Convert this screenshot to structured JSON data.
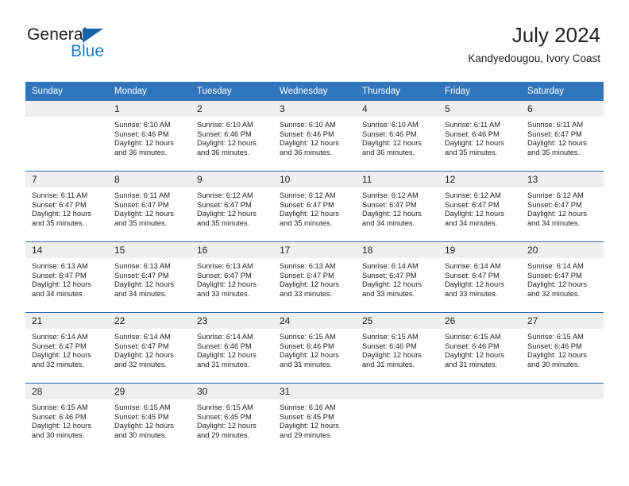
{
  "brand": {
    "word_general": "General",
    "word_blue": "Blue",
    "triangle_icon": "brand-triangle-icon"
  },
  "header": {
    "title": "July 2024",
    "location": "Kandyedougou, Ivory Coast"
  },
  "colors": {
    "header_blue": "#3176bc",
    "row_separator_blue": "#2a6ab0",
    "daynum_background": "#efefef",
    "brand_blue": "#1c7fd6",
    "text": "#231f20"
  },
  "weekday_headers": [
    "Sunday",
    "Monday",
    "Tuesday",
    "Wednesday",
    "Thursday",
    "Friday",
    "Saturday"
  ],
  "weeks": [
    [
      {
        "day": "",
        "blank": true,
        "sunrise": "",
        "sunset": "",
        "daylight1": "",
        "daylight2": ""
      },
      {
        "day": "1",
        "sunrise": "Sunrise: 6:10 AM",
        "sunset": "Sunset: 6:46 PM",
        "daylight1": "Daylight: 12 hours",
        "daylight2": "and 36 minutes."
      },
      {
        "day": "2",
        "sunrise": "Sunrise: 6:10 AM",
        "sunset": "Sunset: 6:46 PM",
        "daylight1": "Daylight: 12 hours",
        "daylight2": "and 36 minutes."
      },
      {
        "day": "3",
        "sunrise": "Sunrise: 6:10 AM",
        "sunset": "Sunset: 6:46 PM",
        "daylight1": "Daylight: 12 hours",
        "daylight2": "and 36 minutes."
      },
      {
        "day": "4",
        "sunrise": "Sunrise: 6:10 AM",
        "sunset": "Sunset: 6:46 PM",
        "daylight1": "Daylight: 12 hours",
        "daylight2": "and 36 minutes."
      },
      {
        "day": "5",
        "sunrise": "Sunrise: 6:11 AM",
        "sunset": "Sunset: 6:46 PM",
        "daylight1": "Daylight: 12 hours",
        "daylight2": "and 35 minutes."
      },
      {
        "day": "6",
        "sunrise": "Sunrise: 6:11 AM",
        "sunset": "Sunset: 6:47 PM",
        "daylight1": "Daylight: 12 hours",
        "daylight2": "and 35 minutes."
      }
    ],
    [
      {
        "day": "7",
        "sunrise": "Sunrise: 6:11 AM",
        "sunset": "Sunset: 6:47 PM",
        "daylight1": "Daylight: 12 hours",
        "daylight2": "and 35 minutes."
      },
      {
        "day": "8",
        "sunrise": "Sunrise: 6:11 AM",
        "sunset": "Sunset: 6:47 PM",
        "daylight1": "Daylight: 12 hours",
        "daylight2": "and 35 minutes."
      },
      {
        "day": "9",
        "sunrise": "Sunrise: 6:12 AM",
        "sunset": "Sunset: 6:47 PM",
        "daylight1": "Daylight: 12 hours",
        "daylight2": "and 35 minutes."
      },
      {
        "day": "10",
        "sunrise": "Sunrise: 6:12 AM",
        "sunset": "Sunset: 6:47 PM",
        "daylight1": "Daylight: 12 hours",
        "daylight2": "and 35 minutes."
      },
      {
        "day": "11",
        "sunrise": "Sunrise: 6:12 AM",
        "sunset": "Sunset: 6:47 PM",
        "daylight1": "Daylight: 12 hours",
        "daylight2": "and 34 minutes."
      },
      {
        "day": "12",
        "sunrise": "Sunrise: 6:12 AM",
        "sunset": "Sunset: 6:47 PM",
        "daylight1": "Daylight: 12 hours",
        "daylight2": "and 34 minutes."
      },
      {
        "day": "13",
        "sunrise": "Sunrise: 6:12 AM",
        "sunset": "Sunset: 6:47 PM",
        "daylight1": "Daylight: 12 hours",
        "daylight2": "and 34 minutes."
      }
    ],
    [
      {
        "day": "14",
        "sunrise": "Sunrise: 6:13 AM",
        "sunset": "Sunset: 6:47 PM",
        "daylight1": "Daylight: 12 hours",
        "daylight2": "and 34 minutes."
      },
      {
        "day": "15",
        "sunrise": "Sunrise: 6:13 AM",
        "sunset": "Sunset: 6:47 PM",
        "daylight1": "Daylight: 12 hours",
        "daylight2": "and 34 minutes."
      },
      {
        "day": "16",
        "sunrise": "Sunrise: 6:13 AM",
        "sunset": "Sunset: 6:47 PM",
        "daylight1": "Daylight: 12 hours",
        "daylight2": "and 33 minutes."
      },
      {
        "day": "17",
        "sunrise": "Sunrise: 6:13 AM",
        "sunset": "Sunset: 6:47 PM",
        "daylight1": "Daylight: 12 hours",
        "daylight2": "and 33 minutes."
      },
      {
        "day": "18",
        "sunrise": "Sunrise: 6:14 AM",
        "sunset": "Sunset: 6:47 PM",
        "daylight1": "Daylight: 12 hours",
        "daylight2": "and 33 minutes."
      },
      {
        "day": "19",
        "sunrise": "Sunrise: 6:14 AM",
        "sunset": "Sunset: 6:47 PM",
        "daylight1": "Daylight: 12 hours",
        "daylight2": "and 33 minutes."
      },
      {
        "day": "20",
        "sunrise": "Sunrise: 6:14 AM",
        "sunset": "Sunset: 6:47 PM",
        "daylight1": "Daylight: 12 hours",
        "daylight2": "and 32 minutes."
      }
    ],
    [
      {
        "day": "21",
        "sunrise": "Sunrise: 6:14 AM",
        "sunset": "Sunset: 6:47 PM",
        "daylight1": "Daylight: 12 hours",
        "daylight2": "and 32 minutes."
      },
      {
        "day": "22",
        "sunrise": "Sunrise: 6:14 AM",
        "sunset": "Sunset: 6:47 PM",
        "daylight1": "Daylight: 12 hours",
        "daylight2": "and 32 minutes."
      },
      {
        "day": "23",
        "sunrise": "Sunrise: 6:14 AM",
        "sunset": "Sunset: 6:46 PM",
        "daylight1": "Daylight: 12 hours",
        "daylight2": "and 31 minutes."
      },
      {
        "day": "24",
        "sunrise": "Sunrise: 6:15 AM",
        "sunset": "Sunset: 6:46 PM",
        "daylight1": "Daylight: 12 hours",
        "daylight2": "and 31 minutes."
      },
      {
        "day": "25",
        "sunrise": "Sunrise: 6:15 AM",
        "sunset": "Sunset: 6:46 PM",
        "daylight1": "Daylight: 12 hours",
        "daylight2": "and 31 minutes."
      },
      {
        "day": "26",
        "sunrise": "Sunrise: 6:15 AM",
        "sunset": "Sunset: 6:46 PM",
        "daylight1": "Daylight: 12 hours",
        "daylight2": "and 31 minutes."
      },
      {
        "day": "27",
        "sunrise": "Sunrise: 6:15 AM",
        "sunset": "Sunset: 6:46 PM",
        "daylight1": "Daylight: 12 hours",
        "daylight2": "and 30 minutes."
      }
    ],
    [
      {
        "day": "28",
        "sunrise": "Sunrise: 6:15 AM",
        "sunset": "Sunset: 6:46 PM",
        "daylight1": "Daylight: 12 hours",
        "daylight2": "and 30 minutes."
      },
      {
        "day": "29",
        "sunrise": "Sunrise: 6:15 AM",
        "sunset": "Sunset: 6:45 PM",
        "daylight1": "Daylight: 12 hours",
        "daylight2": "and 30 minutes."
      },
      {
        "day": "30",
        "sunrise": "Sunrise: 6:15 AM",
        "sunset": "Sunset: 6:45 PM",
        "daylight1": "Daylight: 12 hours",
        "daylight2": "and 29 minutes."
      },
      {
        "day": "31",
        "sunrise": "Sunrise: 6:16 AM",
        "sunset": "Sunset: 6:45 PM",
        "daylight1": "Daylight: 12 hours",
        "daylight2": "and 29 minutes."
      },
      {
        "day": "",
        "blank": true,
        "sunrise": "",
        "sunset": "",
        "daylight1": "",
        "daylight2": ""
      },
      {
        "day": "",
        "blank": true,
        "sunrise": "",
        "sunset": "",
        "daylight1": "",
        "daylight2": ""
      },
      {
        "day": "",
        "blank": true,
        "sunrise": "",
        "sunset": "",
        "daylight1": "",
        "daylight2": ""
      }
    ]
  ]
}
